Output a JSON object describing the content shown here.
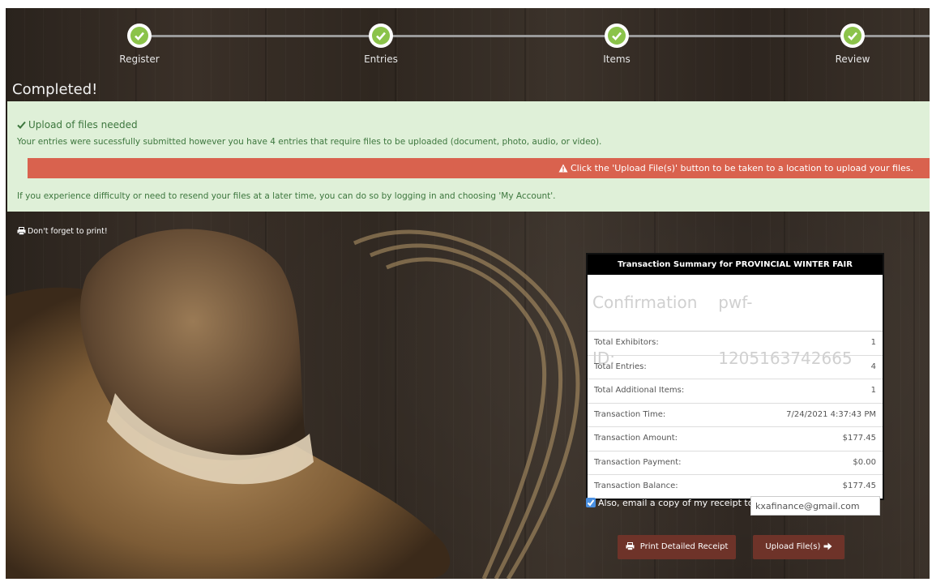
{
  "steps": [
    {
      "label": "Register"
    },
    {
      "label": "Entries"
    },
    {
      "label": "Items"
    },
    {
      "label": "Review"
    }
  ],
  "page_title": "Completed!",
  "alert": {
    "heading": "Upload of files needed",
    "line1": "Your entries were sucessfully submitted however you have 4 entries that require files to be uploaded (document, photo, audio, or video).",
    "warning": "Click the 'Upload File(s)' button to be taken to a location to upload your files.",
    "line2": "If you experience difficulty or need to resend your files at a later time, you can do so by logging in and choosing 'My Account'."
  },
  "print_note": "Don't forget to print!",
  "summary": {
    "title": "Transaction Summary for PROVINCIAL WINTER FAIR",
    "confirmation_label": "Confirmation ID:",
    "confirmation_id": "pwf-1205163742665",
    "rows": [
      {
        "label": "Total Exhibitors:",
        "value": "1"
      },
      {
        "label": "Total Entries:",
        "value": "4"
      },
      {
        "label": "Total Additional Items:",
        "value": "1"
      },
      {
        "label": "Transaction Time:",
        "value": "7/24/2021 4:37:43 PM"
      },
      {
        "label": "Transaction Amount:",
        "value": "$177.45"
      },
      {
        "label": "Transaction Payment:",
        "value": "$0.00"
      },
      {
        "label": "Transaction Balance:",
        "value": "$177.45"
      }
    ]
  },
  "email": {
    "checked": true,
    "label": "Also, email a copy of my receipt to:",
    "value": "kxafinance@gmail.com"
  },
  "buttons": {
    "print_receipt": "Print Detailed Receipt",
    "upload_files": "Upload File(s)"
  },
  "icons": {
    "step": "check-icon",
    "heading": "check-icon",
    "warning": "warning-triangle-icon",
    "print": "printer-icon",
    "upload": "arrow-right-icon"
  },
  "colors": {
    "step_done": "#8bc34a",
    "alert_bg": "#dff0d8",
    "alert_text": "#3c763d",
    "warning_bg": "#d9624e",
    "button_bg": "#6e3329"
  }
}
